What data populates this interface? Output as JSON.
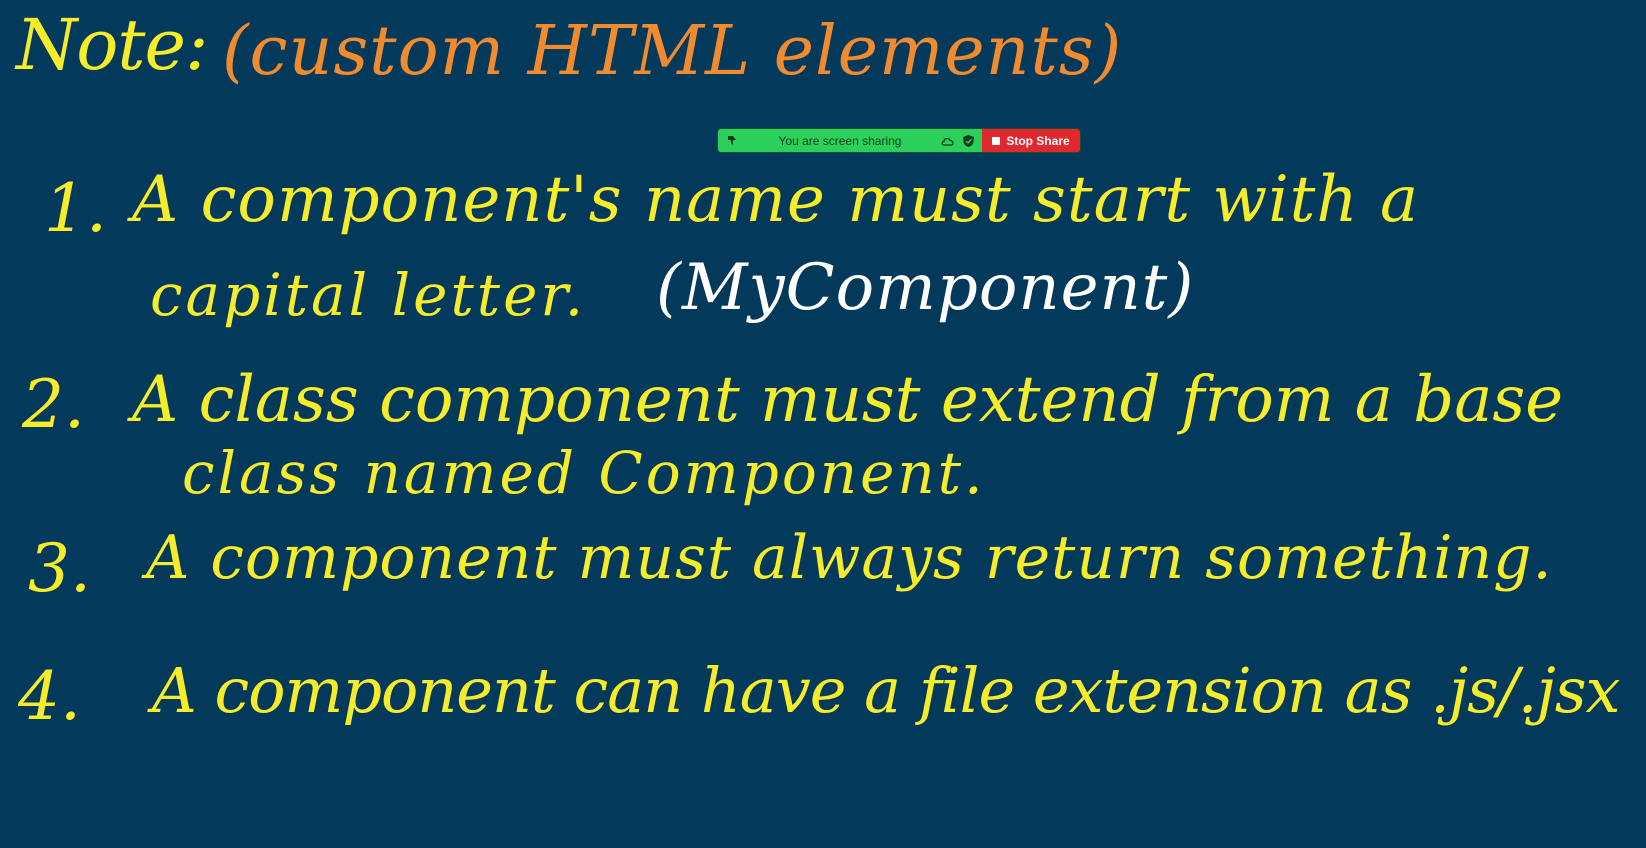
{
  "colors": {
    "background": "#033a5c",
    "yellow_ink": "#f6ec2a",
    "orange_ink": "#f28a2e",
    "white_ink": "#ffffff",
    "share_green": "#2bd05a",
    "stop_red": "#e0282e"
  },
  "whiteboard": {
    "title": {
      "note_label": "Note:",
      "heading": "(custom HTML elements)"
    },
    "items": [
      {
        "number": "1.",
        "lines": [
          "A component's name must start with a",
          "capital letter."
        ],
        "example": "(MyComponent)"
      },
      {
        "number": "2.",
        "lines": [
          "A class component must extend from a base",
          "class named Component."
        ]
      },
      {
        "number": "3.",
        "lines": [
          "A component must always return something."
        ]
      },
      {
        "number": "4.",
        "lines": [
          "A component can have a file extension as .js/.jsx"
        ]
      }
    ]
  },
  "share_bar": {
    "status_text": "You are screen sharing",
    "stop_label": "Stop Share",
    "icons": [
      "pin-icon",
      "cloud-icon",
      "shield-check-icon",
      "stop-square-icon"
    ]
  }
}
